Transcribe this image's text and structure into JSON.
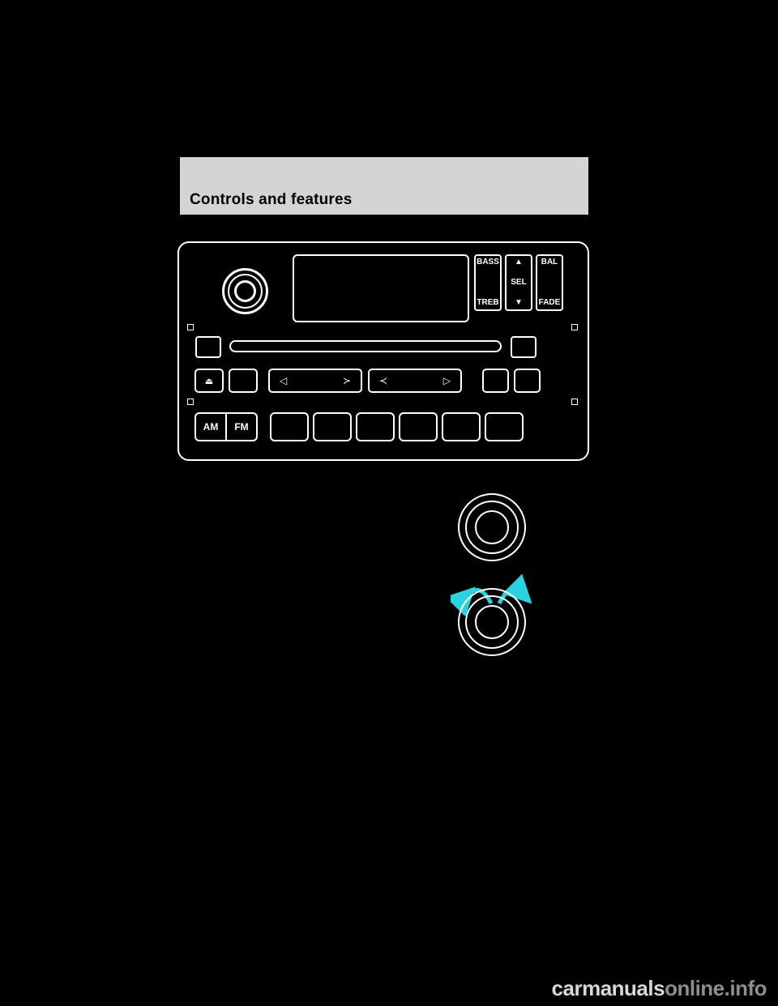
{
  "page": {
    "background_color": "#000000",
    "header": {
      "title": "Controls and features",
      "band_color": "#d4d4d4"
    },
    "watermark": {
      "text_light": "carmanuals",
      "text_dark": "online.info"
    }
  },
  "radio": {
    "name": "car-audio-faceplate",
    "display": {
      "text": ""
    },
    "top_keys": [
      {
        "name": "bass-treb-key",
        "upper_label": "BASS",
        "lower_label": "TREB"
      },
      {
        "name": "sel-key",
        "upper_label": "▲",
        "middle_label": "SEL",
        "lower_label": "▼"
      },
      {
        "name": "bal-fade-key",
        "upper_label": "BAL",
        "lower_label": "FADE"
      }
    ],
    "mid_row": [
      {
        "name": "eject-button",
        "label": "⏏"
      },
      {
        "name": "unlabeled-button-1",
        "label": ""
      },
      {
        "name": "seek-rocker",
        "left_label": "◁",
        "right_label": "≻"
      },
      {
        "name": "tune-rocker",
        "left_label": "≺",
        "right_label": "▷"
      },
      {
        "name": "unlabeled-button-2",
        "label": ""
      },
      {
        "name": "unlabeled-button-3",
        "label": ""
      }
    ],
    "band_selector": {
      "am_label": "AM",
      "fm_label": "FM"
    },
    "presets": [
      {
        "name": "preset-1",
        "label": ""
      },
      {
        "name": "preset-2",
        "label": ""
      },
      {
        "name": "preset-3",
        "label": ""
      },
      {
        "name": "preset-4",
        "label": ""
      },
      {
        "name": "preset-5",
        "label": ""
      },
      {
        "name": "preset-6",
        "label": ""
      }
    ]
  },
  "figures": [
    {
      "name": "volume-knob-figure",
      "caption": ""
    },
    {
      "name": "volume-knob-rotate-figure",
      "caption": "",
      "arrow_color": "#2ad2e0"
    }
  ]
}
